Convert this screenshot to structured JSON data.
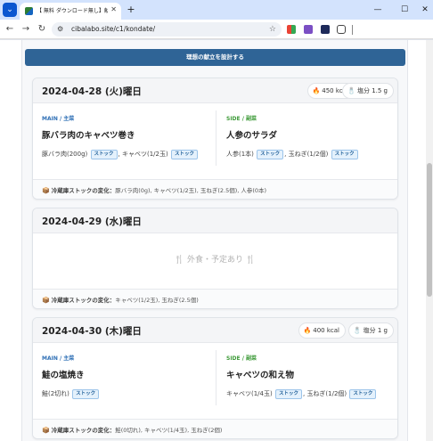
{
  "browser": {
    "tab_title": "【 無料 ダウンロード無し】献立 の…",
    "tab_close": "✕",
    "new_tab": "+",
    "window_minimize": "—",
    "window_maximize": "☐",
    "window_close": "✕",
    "url": "cibalabo.site/c1/kondate/",
    "icons": [
      "chevron-down-icon",
      "back-icon",
      "forward-icon",
      "reload-icon",
      "site-info-icon",
      "star-icon"
    ]
  },
  "page": {
    "design_button": "理想の献立を設計する",
    "days": [
      {
        "date": "2024-04-28 (火)曜日",
        "kcal": "450 kcal",
        "salt": "塩分 1.5 g",
        "main_label": "MAIN / 主菜",
        "main_dish": "豚バラ肉のキャベツ巻き",
        "main_ingredients": [
          {
            "name": "豚バラ肉(200g)",
            "badge": "ストック"
          },
          {
            "name": "キャベツ(1/2玉)",
            "badge": "ストック"
          }
        ],
        "side_label": "SIDE / 副菜",
        "side_dish": "人参のサラダ",
        "side_ingredients": [
          {
            "name": "人参(1本)",
            "badge": "ストック"
          },
          {
            "name": "玉ねぎ(1/2個)",
            "badge": "ストック"
          }
        ],
        "stock_label": "冷蔵庫ストックの変化：",
        "stock_change": "豚バラ肉(0g), キャベツ(1/2玉), 玉ねぎ(2.5個), 人参(0本)"
      },
      {
        "date": "2024-04-29 (水)曜日",
        "eat_out": "🍴 外食・予定あり 🍴",
        "stock_label": "冷蔵庫ストックの変化：",
        "stock_change": "キャベツ(1/2玉), 玉ねぎ(2.5個)"
      },
      {
        "date": "2024-04-30 (木)曜日",
        "kcal": "400 kcal",
        "salt": "塩分 1 g",
        "main_label": "MAIN / 主菜",
        "main_dish": "鮭の塩焼き",
        "main_ingredients": [
          {
            "name": "鮭(2切れ)",
            "badge": "ストック"
          }
        ],
        "side_label": "SIDE / 副菜",
        "side_dish": "キャベツの和え物",
        "side_ingredients": [
          {
            "name": "キャベツ(1/4玉)",
            "badge": "ストック"
          },
          {
            "name": "玉ねぎ(1/2個)",
            "badge": "ストック"
          }
        ],
        "stock_label": "冷蔵庫ストックの変化：",
        "stock_change": "鮭(0切れ), キャベツ(1/4玉), 玉ねぎ(2個)"
      }
    ]
  },
  "colors": {
    "primary_button": "#2f6496",
    "main_label": "#2e6fb5",
    "side_label": "#3f9b3a",
    "stock_badge": "#e4f1fc"
  }
}
